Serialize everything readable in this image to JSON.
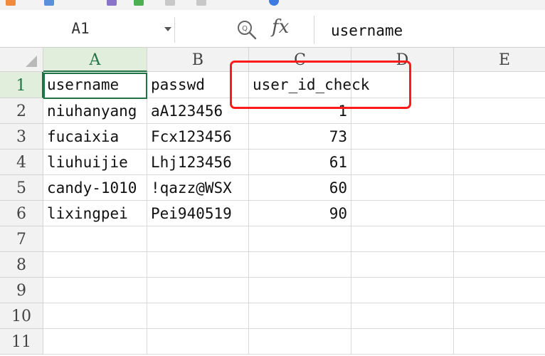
{
  "toolbar": {
    "icons": [
      "toolbar-icon-orange",
      "toolbar-icon-blue",
      "toolbar-icon-purple",
      "toolbar-icon-green",
      "undo-icon",
      "redo-icon"
    ]
  },
  "formula_bar": {
    "name_box": "A1",
    "fx_label": "fx",
    "formula": "username"
  },
  "sheet": {
    "columns": [
      "A",
      "B",
      "C",
      "D",
      "E"
    ],
    "rows": [
      "1",
      "2",
      "3",
      "4",
      "5",
      "6",
      "7",
      "8",
      "9",
      "10",
      "11"
    ],
    "header_row": [
      "username",
      "passwd",
      "user_id_check"
    ],
    "data": [
      [
        "niuhanyang",
        "aA123456",
        "1"
      ],
      [
        "fucaixia",
        "Fcx123456",
        "73"
      ],
      [
        "liuhuijie",
        "Lhj123456",
        "61"
      ],
      [
        "candy-1010",
        "!qazz@WSX",
        "60"
      ],
      [
        "lixingpei",
        "Pei940519",
        "90"
      ]
    ]
  },
  "colors": {
    "accent_green": "#217346",
    "annotation_red": "#ff1a1a"
  }
}
